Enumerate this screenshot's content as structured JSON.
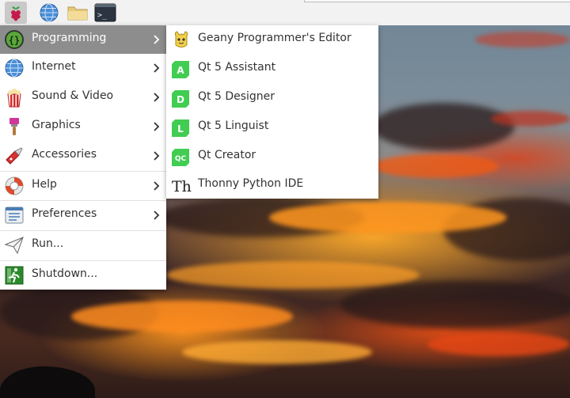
{
  "panel": {
    "menu_button": "raspberry-icon",
    "launchers": [
      "globe-icon",
      "folder-icon",
      "terminal-icon"
    ],
    "terminal_glyph": ">_"
  },
  "main_menu": {
    "items": [
      {
        "label": "Programming",
        "icon": "programming-icon",
        "has_submenu": true,
        "active": true
      },
      {
        "label": "Internet",
        "icon": "globe-icon",
        "has_submenu": true
      },
      {
        "label": "Sound & Video",
        "icon": "popcorn-icon",
        "has_submenu": true
      },
      {
        "label": "Graphics",
        "icon": "paintbrush-icon",
        "has_submenu": true
      },
      {
        "label": "Accessories",
        "icon": "accessories-icon",
        "has_submenu": true
      },
      {
        "label": "Help",
        "icon": "lifebuoy-icon",
        "has_submenu": true
      },
      {
        "label": "Preferences",
        "icon": "preferences-icon",
        "has_submenu": true
      },
      {
        "label": "Run...",
        "icon": "paper-plane-icon",
        "has_submenu": false
      },
      {
        "label": "Shutdown...",
        "icon": "exit-icon",
        "has_submenu": false
      }
    ]
  },
  "sub_menu": {
    "items": [
      {
        "label": "Geany Programmer's Editor",
        "icon": "geany-icon"
      },
      {
        "label": "Qt 5 Assistant",
        "icon": "qt-assistant-icon",
        "badge": "A"
      },
      {
        "label": "Qt 5 Designer",
        "icon": "qt-designer-icon",
        "badge": "D"
      },
      {
        "label": "Qt 5 Linguist",
        "icon": "qt-linguist-icon",
        "badge": "L"
      },
      {
        "label": "Qt Creator",
        "icon": "qt-creator-icon",
        "badge": "QC"
      },
      {
        "label": "Thonny Python IDE",
        "icon": "thonny-icon",
        "badge": "Th"
      }
    ]
  },
  "colors": {
    "active_item": "#8d8d8d",
    "qt_green": "#41cd52",
    "menu_bg": "#ffffff",
    "panel_bg": "#f2f2f2"
  }
}
